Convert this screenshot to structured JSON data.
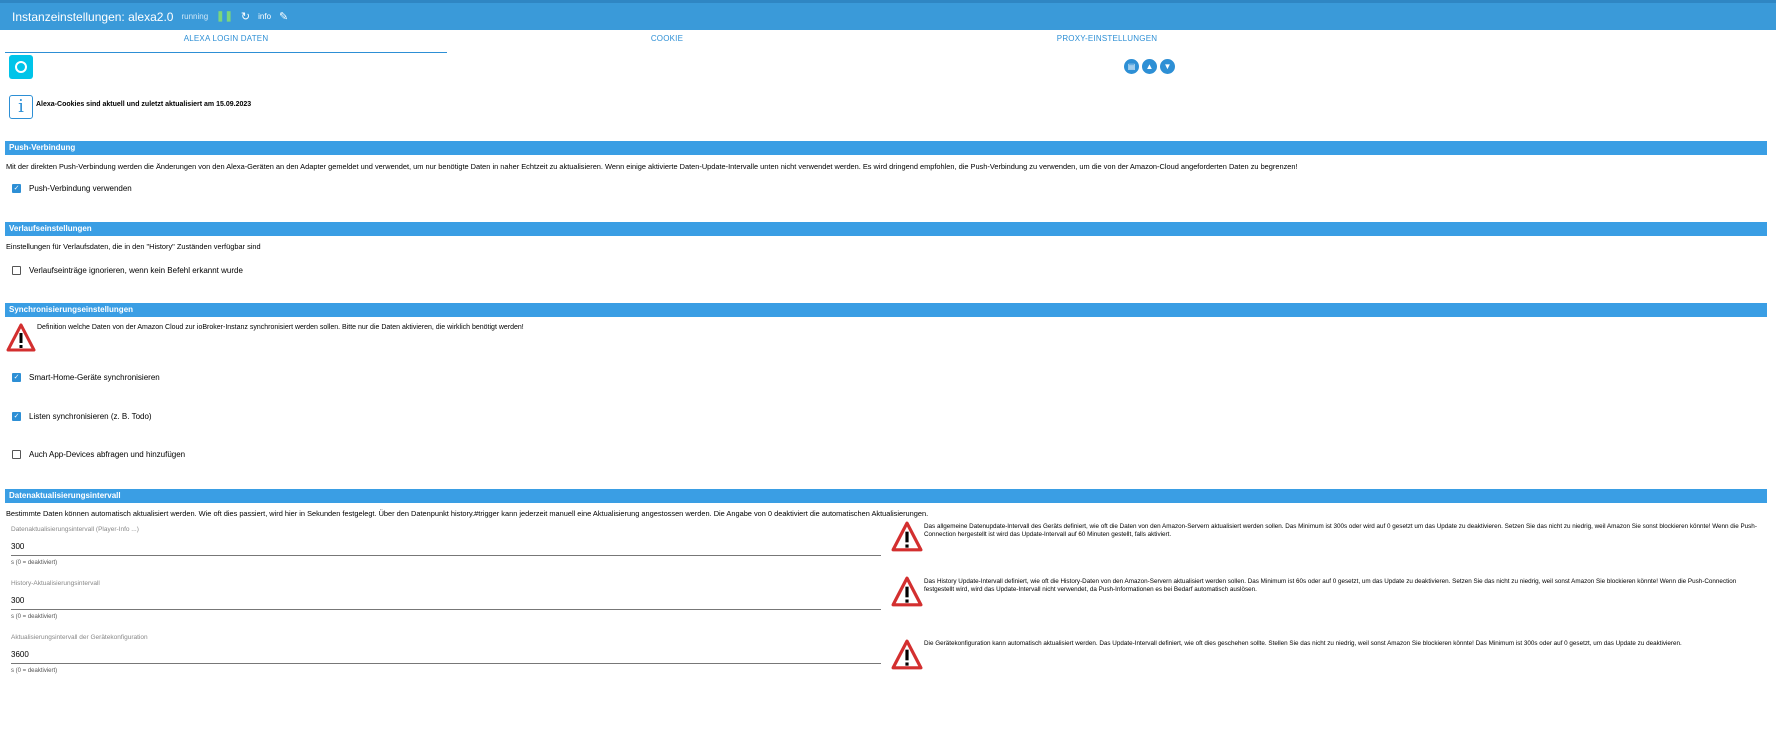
{
  "header": {
    "title": "Instanzeinstellungen: alexa2.0",
    "status_small": "running",
    "info_label": "info"
  },
  "tabs": [
    {
      "label": "Alexa Login Daten",
      "active": true
    },
    {
      "label": "Cookie",
      "active": false
    },
    {
      "label": "Proxy-Einstellungen",
      "active": false
    }
  ],
  "icons": {
    "alexa_logo": "alexa-logo",
    "buttons": [
      "book-icon",
      "upload-icon",
      "download-icon"
    ],
    "pause": "pause-icon",
    "refresh": "refresh-icon",
    "edit": "pencil-icon"
  },
  "cookie_info": "Alexa-Cookies sind aktuell und zuletzt aktualisiert am 15.09.2023",
  "push": {
    "title": "Push-Verbindung",
    "description": "Mit der direkten Push-Verbindung werden die Änderungen von den Alexa-Geräten an den Adapter gemeldet und verwendet, um nur benötigte Daten in naher Echtzeit zu aktualisieren. Wenn einige aktivierte Daten-Update-Intervalle unten nicht verwendet werden. Es wird dringend empfohlen, die Push-Verbindung zu verwenden, um die von der Amazon-Cloud angeforderten Daten zu begrenzen!",
    "checkbox_label": "Push-Verbindung verwenden",
    "checked": true
  },
  "history": {
    "title": "Verlaufseinstellungen",
    "description": "Einstellungen für Verlaufsdaten, die in den \"History\" Zuständen verfügbar sind",
    "checkbox_label": "Verlaufseinträge ignorieren, wenn kein Befehl erkannt wurde",
    "checked": false
  },
  "sync": {
    "title": "Synchronisierungseinstellungen",
    "warning": "Definition welche Daten von der Amazon Cloud zur ioBroker-Instanz synchronisiert werden sollen. Bitte nur die Daten aktivieren, die wirklich benötigt werden!",
    "options": [
      {
        "label": "Smart-Home-Geräte synchronisieren",
        "checked": true
      },
      {
        "label": "Listen synchronisieren (z. B. Todo)",
        "checked": true
      },
      {
        "label": "Auch App-Devices abfragen und hinzufügen",
        "checked": false
      }
    ]
  },
  "interval": {
    "title": "Datenaktualisierungsintervall",
    "description": "Bestimmte Daten können automatisch aktualisiert werden. Wie oft dies passiert, wird hier in Sekunden festgelegt. Über den Datenpunkt history.#trigger kann jederzeit manuell eine Aktualisierung angestossen werden. Die Angabe von 0 deaktiviert die automatischen Aktualisierungen.",
    "fields": [
      {
        "label": "Datenaktualisierungsintervall (Player-Info ...)",
        "value": "300",
        "help": "s (0 = deaktiviert)",
        "warning": "Das allgemeine Datenupdate-Intervall des Geräts definiert, wie oft die Daten von den Amazon-Servern aktualisiert werden sollen. Das Minimum ist 300s oder wird auf 0 gesetzt um das Update zu deaktivieren. Setzen Sie das nicht zu niedrig, weil Amazon Sie sonst blockieren könnte! Wenn die Push-Connection hergestellt ist wird das Update-Intervall auf 60 Minuten gestellt, falls aktiviert."
      },
      {
        "label": "History-Aktualisierungsintervall",
        "value": "300",
        "help": "s (0 = deaktiviert)",
        "warning": "Das History Update-Intervall definiert, wie oft die History-Daten von den Amazon-Servern aktualisiert werden sollen. Das Minimum ist 60s oder auf 0 gesetzt, um das Update zu deaktivieren. Setzen Sie das nicht zu niedrig, weil sonst Amazon Sie blockieren könnte! Wenn die Push-Connection festgestellt wird, wird das Update-Intervall nicht verwendet, da Push-Informationen es bei Bedarf automatisch auslösen."
      },
      {
        "label": "Aktualisierungsintervall der Gerätekonfiguration",
        "value": "3600",
        "help": "s (0 = deaktiviert)",
        "warning": "Die Gerätekonfiguration kann automatisch aktualisiert werden. Das Update-Intervall definiert, wie oft dies geschehen sollte. Stellen Sie das nicht zu niedrig, weil sonst Amazon Sie blockieren könnte! Das Minimum ist 300s oder auf 0 gesetzt, um das Update zu deaktivieren."
      }
    ]
  }
}
